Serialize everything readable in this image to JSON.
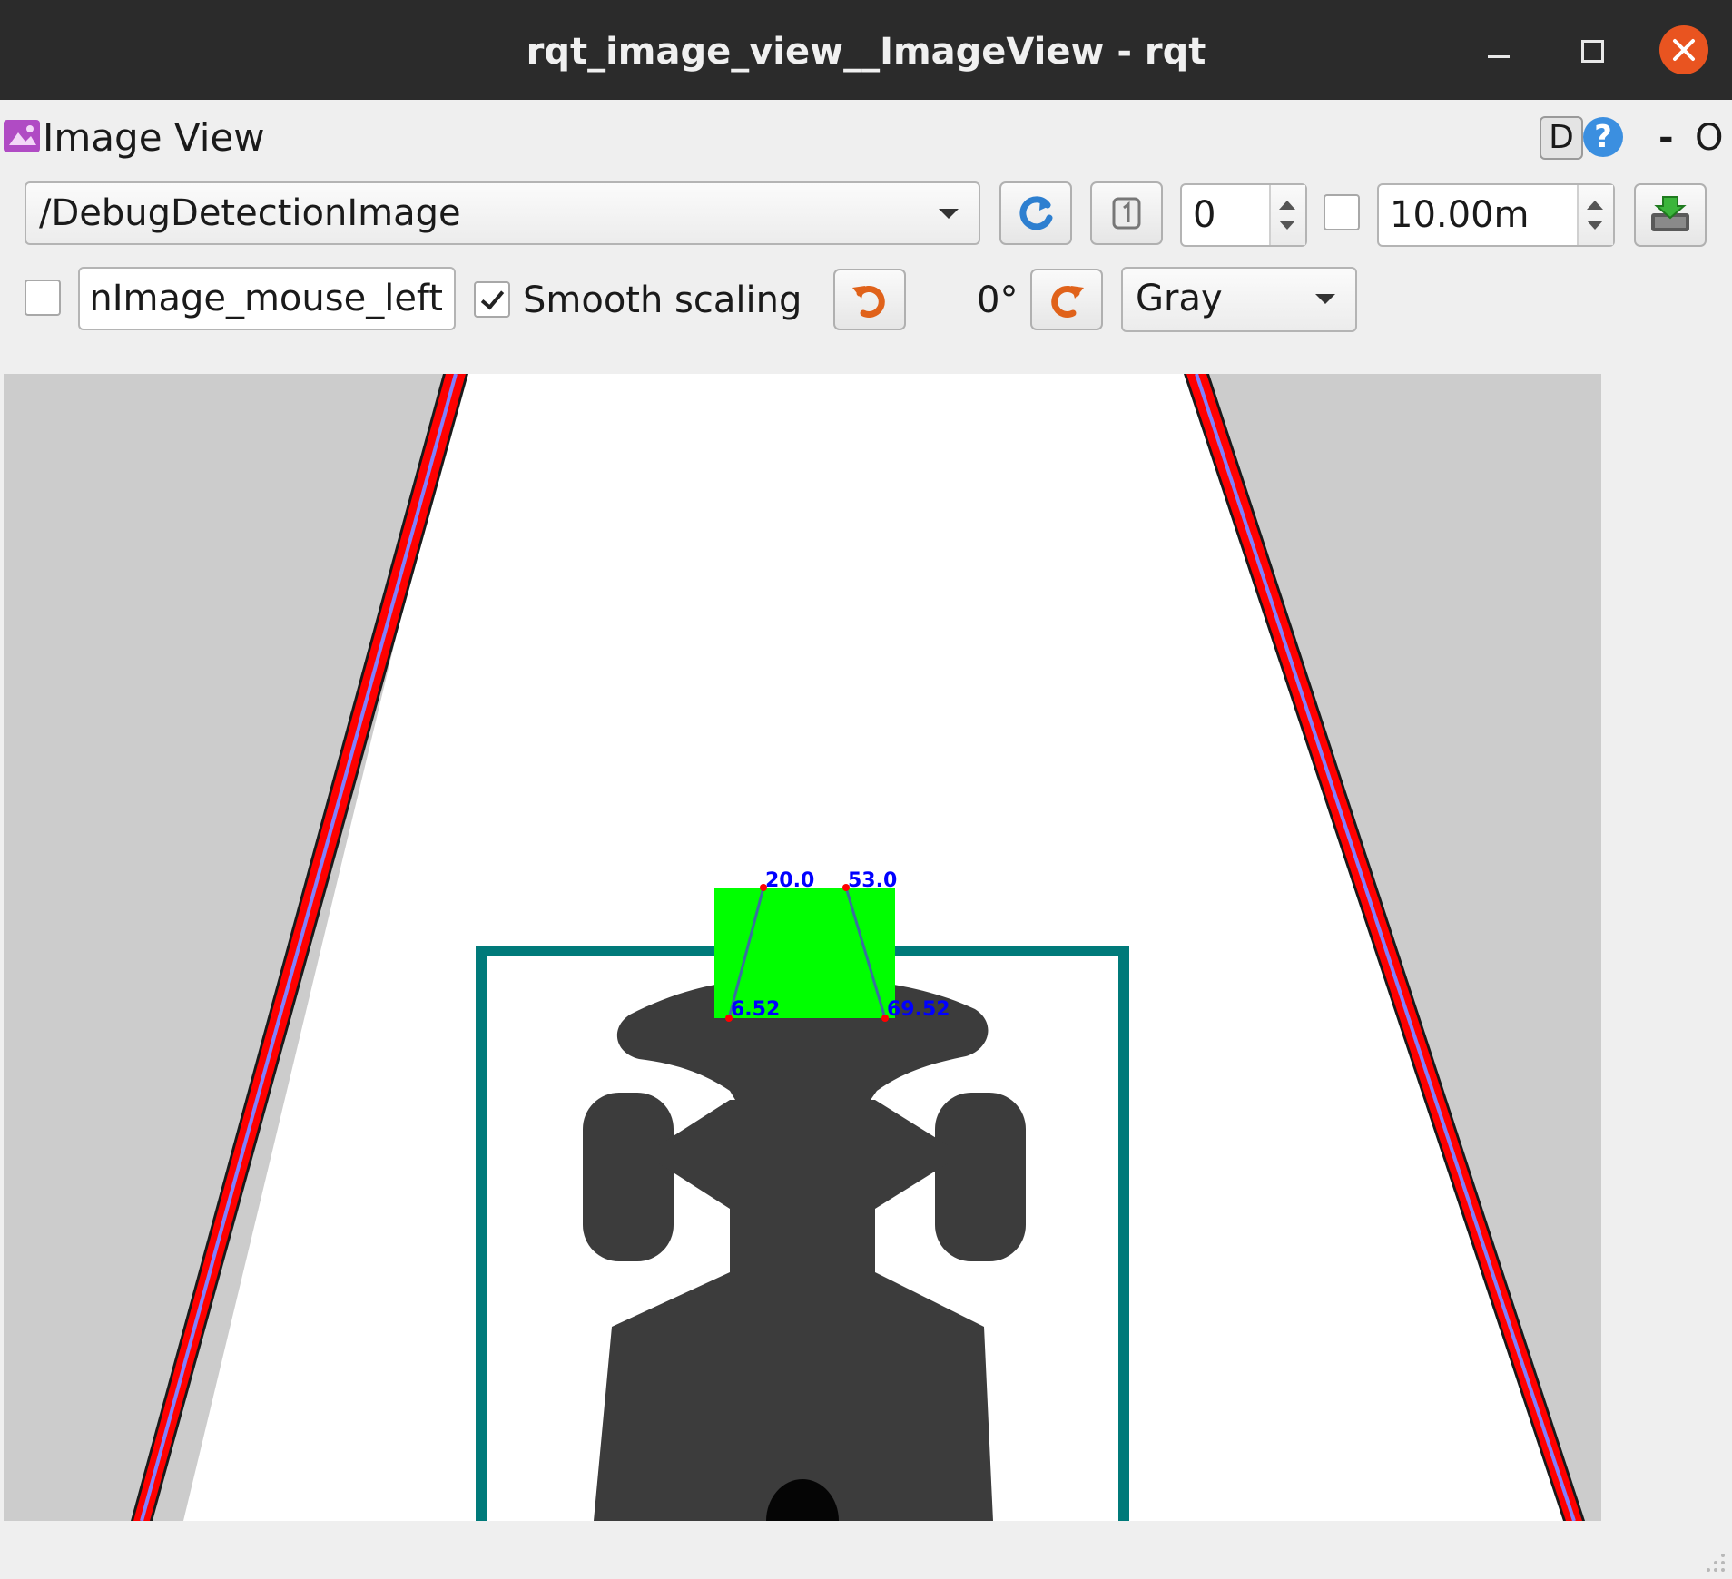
{
  "window": {
    "title": "rqt_image_view__ImageView - rqt"
  },
  "plugin": {
    "title": "Image View",
    "help_d_label": "D",
    "help_label": "?",
    "minimize_label": "-",
    "close_label": "O"
  },
  "toolbar": {
    "topic": "/DebugDetectionImage",
    "number_value": "0",
    "timeout_value": "10.00m",
    "mouse_topic_value": "nImage_mouse_left",
    "mouse_publish_checked": false,
    "timeout_checked": false,
    "smooth_scaling_label": "Smooth scaling",
    "smooth_scaling_checked": true,
    "rotation_label": "0°",
    "color_scheme": "Gray"
  },
  "image": {
    "labels": {
      "top_left": "20.0",
      "top_right": "53.0",
      "bottom_left": "6.52",
      "bottom_right": "69.52"
    },
    "colors": {
      "road": "#ffffff",
      "background": "#cccccc",
      "lane_red": "#ff0000",
      "lane_blue": "#8080ff",
      "bounding_box": "#007a7a",
      "detection_box": "#00ff00",
      "label_text": "#0000ff",
      "robot": "#3c3c3c"
    }
  },
  "icons": {
    "refresh": "refresh-icon",
    "one_to_one": "one-to-one-icon",
    "save": "save-image-icon",
    "rotate_left": "rotate-left-icon",
    "rotate_right": "rotate-right-icon",
    "plugin": "image-plugin-icon"
  }
}
